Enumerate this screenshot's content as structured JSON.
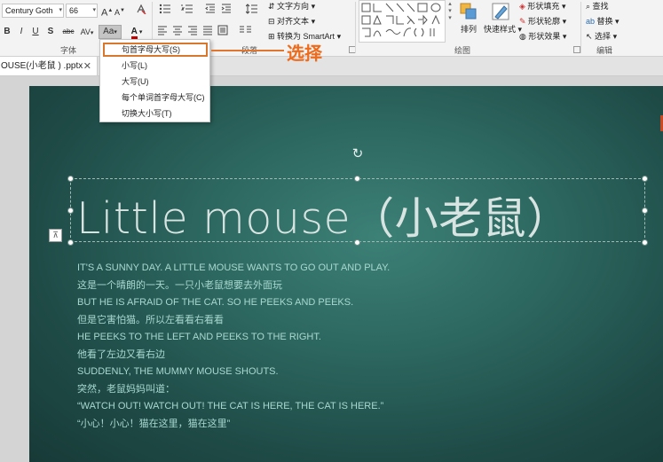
{
  "ribbon": {
    "font_name": "Century Goth",
    "font_size": "66",
    "font_group_label": "字体",
    "paragraph_group_label": "段落",
    "drawing_group_label": "绘图",
    "editing_group_label": "编辑",
    "text_direction": "文字方向",
    "align_text": "对齐文本",
    "convert_smartart": "转换为 SmartArt",
    "arrange": "排列",
    "quick_styles": "快速样式",
    "shape_fill": "形状填充",
    "shape_outline": "形状轮廓",
    "shape_effects": "形状效果",
    "find": "查找",
    "replace": "替换",
    "select": "选择",
    "bold": "B",
    "italic": "I",
    "underline": "U",
    "shadow": "S",
    "strikethrough": "abc",
    "char_spacing": "AV",
    "change_case": "Aa",
    "font_color": "A",
    "grow_font": "A",
    "shrink_font": "A"
  },
  "document_tab": {
    "title": "OUSE(小老鼠 ) .pptx",
    "close": "✕"
  },
  "case_menu": {
    "items": [
      "句首字母大写(S)",
      "小写(L)",
      "大写(U)",
      "每个单词首字母大写(C)",
      "切换大小写(T)"
    ]
  },
  "callout": {
    "text": "选择"
  },
  "slide": {
    "title": "Little mouse（小老鼠）",
    "body": [
      "IT'S A SUNNY DAY. A LITTLE MOUSE WANTS TO GO OUT AND PLAY.",
      "这是一个晴朗的一天。一只小老鼠想要去外面玩",
      "BUT HE IS AFRAID OF THE CAT. SO HE PEEKS AND PEEKS.",
      "但是它害怕猫。所以左看看右看看",
      "HE PEEKS TO THE LEFT AND PEEKS TO THE RIGHT.",
      "他看了左边又看右边",
      "SUDDENLY, THE MUMMY MOUSE SHOUTS.",
      "突然，老鼠妈妈叫道：",
      "“WATCH OUT! WATCH OUT! THE CAT IS HERE, THE CAT IS HERE.”",
      "“小心！小心！猫在这里，猫在这里”"
    ]
  },
  "colors": {
    "accent_orange": "#e07630",
    "slide_bg": "#2d6860",
    "body_text": "#a8d8d0"
  }
}
